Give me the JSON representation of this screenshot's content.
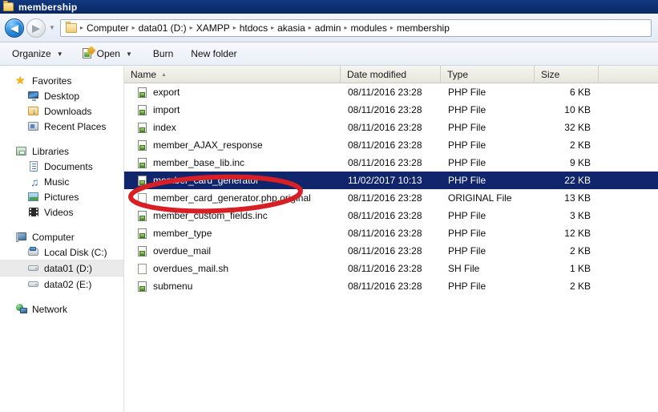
{
  "window": {
    "title": "membership",
    "title_icon": "folder-icon"
  },
  "nav": {
    "back_icon": "back-arrow-icon",
    "forward_icon": "forward-arrow-icon",
    "history_icon": "chevron-down-icon",
    "address_folder_icon": "folder-icon",
    "breadcrumbs": [
      "Computer",
      "data01 (D:)",
      "XAMPP",
      "htdocs",
      "akasia",
      "admin",
      "modules",
      "membership"
    ],
    "separator": "▸"
  },
  "toolbar": {
    "organize_label": "Organize",
    "open_label": "Open",
    "open_icon": "open-file-icon",
    "burn_label": "Burn",
    "new_folder_label": "New folder",
    "dropdown_icon": "chevron-down-icon"
  },
  "sidebar": {
    "groups": [
      {
        "header": {
          "label": "Favorites",
          "icon": "star-icon"
        },
        "items": [
          {
            "label": "Desktop",
            "icon": "desktop-icon"
          },
          {
            "label": "Downloads",
            "icon": "downloads-folder-icon"
          },
          {
            "label": "Recent Places",
            "icon": "recent-places-icon"
          }
        ]
      },
      {
        "header": {
          "label": "Libraries",
          "icon": "libraries-icon"
        },
        "items": [
          {
            "label": "Documents",
            "icon": "document-icon"
          },
          {
            "label": "Music",
            "icon": "music-note-icon"
          },
          {
            "label": "Pictures",
            "icon": "picture-icon"
          },
          {
            "label": "Videos",
            "icon": "video-film-icon"
          }
        ]
      },
      {
        "header": {
          "label": "Computer",
          "icon": "computer-icon"
        },
        "items": [
          {
            "label": "Local Disk (C:)",
            "icon": "hard-disk-icon",
            "selected": false
          },
          {
            "label": "data01 (D:)",
            "icon": "drive-icon",
            "selected": true
          },
          {
            "label": "data02 (E:)",
            "icon": "drive-icon",
            "selected": false
          }
        ]
      },
      {
        "header": {
          "label": "Network",
          "icon": "network-icon"
        },
        "items": []
      }
    ]
  },
  "file_list": {
    "columns": [
      "Name",
      "Date modified",
      "Type",
      "Size"
    ],
    "sort_column": "Name",
    "sort_indicator": "▲",
    "rows": [
      {
        "name": "export",
        "date": "08/11/2016 23:28",
        "type": "PHP File",
        "size": "6 KB",
        "icon": "php-file-icon",
        "selected": false
      },
      {
        "name": "import",
        "date": "08/11/2016 23:28",
        "type": "PHP File",
        "size": "10 KB",
        "icon": "php-file-icon",
        "selected": false
      },
      {
        "name": "index",
        "date": "08/11/2016 23:28",
        "type": "PHP File",
        "size": "32 KB",
        "icon": "php-file-icon",
        "selected": false
      },
      {
        "name": "member_AJAX_response",
        "date": "08/11/2016 23:28",
        "type": "PHP File",
        "size": "2 KB",
        "icon": "php-file-icon",
        "selected": false
      },
      {
        "name": "member_base_lib.inc",
        "date": "08/11/2016 23:28",
        "type": "PHP File",
        "size": "9 KB",
        "icon": "php-file-icon",
        "selected": false
      },
      {
        "name": "member_card_generator",
        "date": "11/02/2017 10:13",
        "type": "PHP File",
        "size": "22 KB",
        "icon": "php-file-icon",
        "selected": true
      },
      {
        "name": "member_card_generator.php.original",
        "date": "08/11/2016 23:28",
        "type": "ORIGINAL File",
        "size": "13 KB",
        "icon": "blank-file-icon",
        "selected": false
      },
      {
        "name": "member_custom_fields.inc",
        "date": "08/11/2016 23:28",
        "type": "PHP File",
        "size": "3 KB",
        "icon": "php-file-icon",
        "selected": false
      },
      {
        "name": "member_type",
        "date": "08/11/2016 23:28",
        "type": "PHP File",
        "size": "12 KB",
        "icon": "php-file-icon",
        "selected": false
      },
      {
        "name": "overdue_mail",
        "date": "08/11/2016 23:28",
        "type": "PHP File",
        "size": "2 KB",
        "icon": "php-file-icon",
        "selected": false
      },
      {
        "name": "overdues_mail.sh",
        "date": "08/11/2016 23:28",
        "type": "SH File",
        "size": "1 KB",
        "icon": "blank-file-icon",
        "selected": false
      },
      {
        "name": "submenu",
        "date": "08/11/2016 23:28",
        "type": "PHP File",
        "size": "2 KB",
        "icon": "php-file-icon",
        "selected": false
      }
    ]
  },
  "annotation": {
    "shape": "ellipse",
    "color": "#d81f26",
    "target_row": "member_card_generator"
  },
  "colors": {
    "title_bar": "#0b2d6e",
    "selection": "#10256b",
    "annotation": "#d81f26"
  }
}
